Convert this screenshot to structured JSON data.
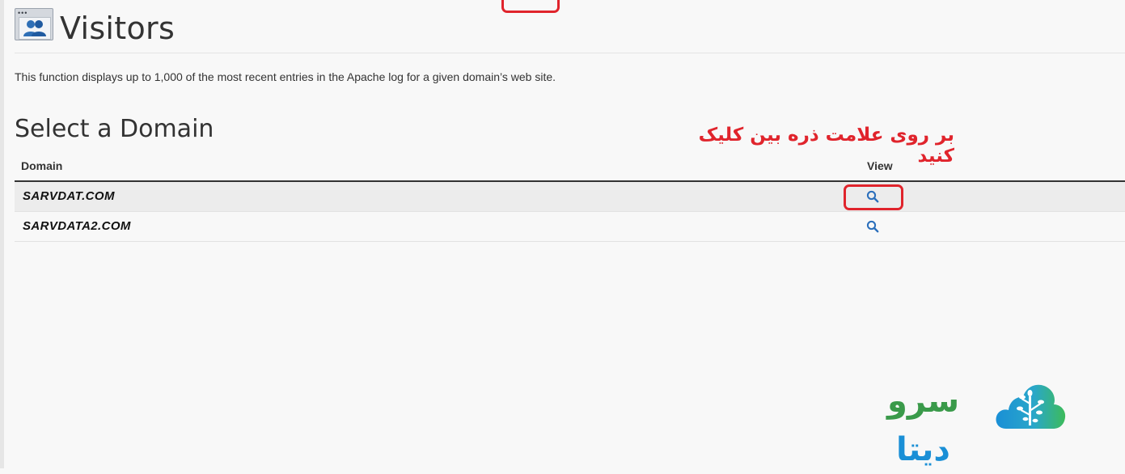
{
  "header": {
    "title": "Visitors",
    "description": "This function displays up to 1,000 of the most recent entries in the Apache log for a given domain’s web site."
  },
  "section": {
    "title": "Select a Domain"
  },
  "table": {
    "columns": {
      "domain": "Domain",
      "view": "View"
    },
    "rows": [
      {
        "domain": "SARVDAT.COM",
        "view_icon": "magnifier-icon"
      },
      {
        "domain": "SARVDATA2.COM",
        "view_icon": "magnifier-icon"
      }
    ]
  },
  "annotation": {
    "text": "بر روی علامت ذره بین کلیک کنید",
    "color": "#e0242c"
  },
  "brand": {
    "text_part1": "سرو",
    "text_part2": "دیتا",
    "color_part1": "#3a9a4a",
    "color_part2": "#1a8fd6",
    "logo_icon": "cloud-tree-icon"
  },
  "colors": {
    "accent": "#2a6ebb",
    "highlight": "#e0242c"
  }
}
